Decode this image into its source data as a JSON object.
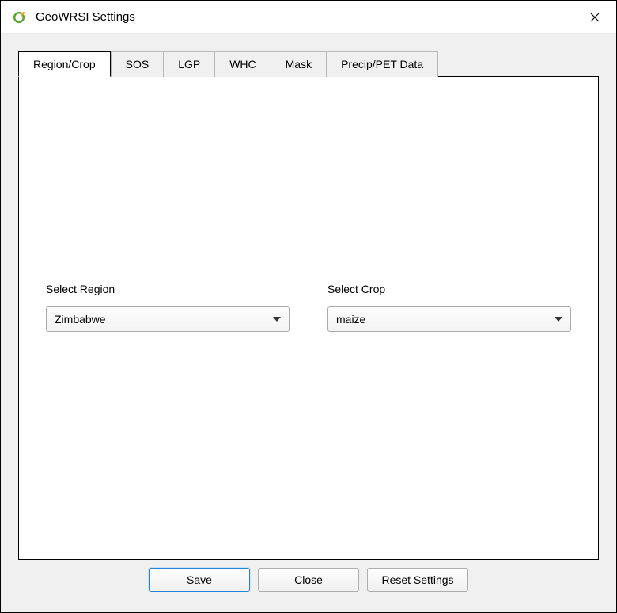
{
  "window": {
    "title": "GeoWRSI Settings"
  },
  "tabs": [
    {
      "label": "Region/Crop",
      "active": true
    },
    {
      "label": "SOS",
      "active": false
    },
    {
      "label": "LGP",
      "active": false
    },
    {
      "label": "WHC",
      "active": false
    },
    {
      "label": "Mask",
      "active": false
    },
    {
      "label": "Precip/PET Data",
      "active": false
    }
  ],
  "panel": {
    "region_label": "Select Region",
    "region_value": "Zimbabwe",
    "crop_label": "Select Crop",
    "crop_value": "maize"
  },
  "footer": {
    "save": "Save",
    "close": "Close",
    "reset": "Reset Settings"
  }
}
